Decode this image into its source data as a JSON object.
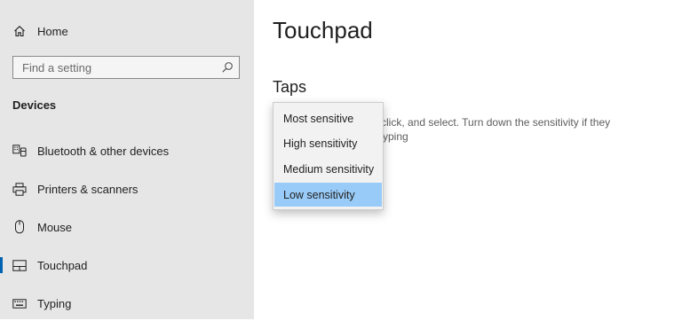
{
  "sidebar": {
    "home_label": "Home",
    "search_placeholder": "Find a setting",
    "section_title": "Devices",
    "items": [
      {
        "label": "Bluetooth & other devices",
        "icon": "keyboard-device-icon"
      },
      {
        "label": "Printers & scanners",
        "icon": "printer-icon"
      },
      {
        "label": "Mouse",
        "icon": "mouse-icon"
      },
      {
        "label": "Touchpad",
        "icon": "touchpad-icon",
        "active": true
      },
      {
        "label": "Typing",
        "icon": "keyboard-icon"
      }
    ]
  },
  "main": {
    "title": "Touchpad",
    "section": "Taps",
    "description_line1": "click, and select. Turn down the sensitivity if they",
    "description_line2": "yping"
  },
  "dropdown": {
    "options": [
      "Most sensitive",
      "High sensitivity",
      "Medium sensitivity",
      "Low sensitivity"
    ],
    "selected": "Low sensitivity"
  },
  "colors": {
    "sidebar_bg": "#e6e6e6",
    "accent": "#0063b1",
    "selected_bg": "#99cbf8"
  }
}
